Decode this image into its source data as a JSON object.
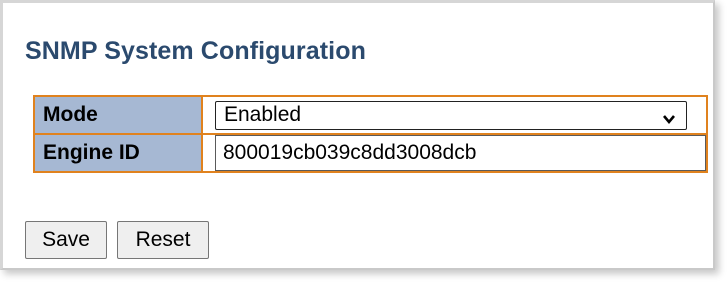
{
  "page": {
    "title": "SNMP System Configuration"
  },
  "form": {
    "mode": {
      "label": "Mode",
      "selected": "Enabled"
    },
    "engine_id": {
      "label": "Engine ID",
      "value": "800019cb039c8dd3008dcb"
    }
  },
  "buttons": {
    "save": "Save",
    "reset": "Reset"
  },
  "colors": {
    "title": "#2b4a6e",
    "param_header": "#a6b8d3",
    "table_border": "#e0821e"
  },
  "icons": {
    "dropdown": "chevron-down-icon"
  }
}
